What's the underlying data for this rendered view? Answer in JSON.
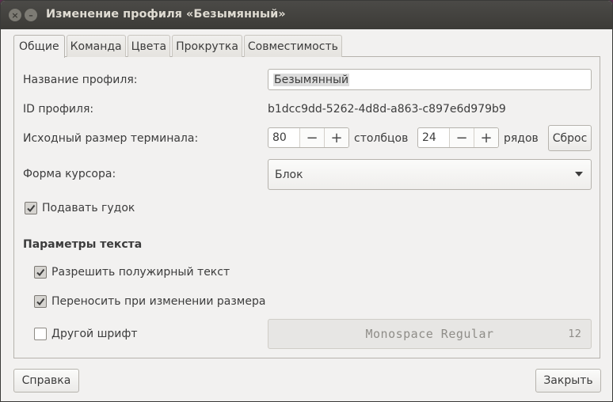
{
  "window": {
    "title": "Изменение профиля «Безымянный»",
    "close_glyph": "×",
    "min_glyph": "–"
  },
  "tabs": [
    {
      "label": "Общие",
      "active": true
    },
    {
      "label": "Команда",
      "active": false
    },
    {
      "label": "Цвета",
      "active": false
    },
    {
      "label": "Прокрутка",
      "active": false
    },
    {
      "label": "Совместимость",
      "active": false
    }
  ],
  "form": {
    "profile_name_label": "Название профиля:",
    "profile_name_value": "Безымянный",
    "profile_id_label": "ID профиля:",
    "profile_id_value": "b1dcc9dd-5262-4d8d-a863-c897e6d979b9",
    "size_label": "Исходный размер терминала:",
    "columns_value": "80",
    "columns_unit": "столбцов",
    "rows_value": "24",
    "rows_unit": "рядов",
    "minus_glyph": "−",
    "plus_glyph": "+",
    "reset_label": "Сброс",
    "cursor_label": "Форма курсора:",
    "cursor_value": "Блок",
    "beep_label": "Подавать гудок",
    "beep_checked": true
  },
  "text_params": {
    "heading": "Параметры текста",
    "bold_label": "Разрешить полужирный текст",
    "bold_checked": true,
    "rewrap_label": "Переносить при изменении размера",
    "rewrap_checked": true,
    "custom_font_label": "Другой шрифт",
    "custom_font_checked": false,
    "font_name": "Monospace Regular",
    "font_size": "12"
  },
  "footer": {
    "help_label": "Справка",
    "close_label": "Закрыть"
  }
}
